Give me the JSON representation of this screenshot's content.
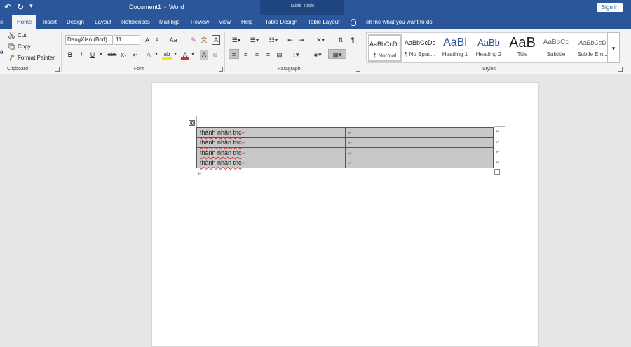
{
  "titlebar": {
    "document": "Document1",
    "separator": "-",
    "app": "Word",
    "table_tools": "Table Tools",
    "sign_in": "Sign in",
    "undo_icon": "↶",
    "redo_icon": "↻",
    "qat_more_icon": "▾"
  },
  "tabs": {
    "file": "e",
    "home": "Home",
    "insert": "Insert",
    "design": "Design",
    "layout": "Layout",
    "references": "References",
    "mailings": "Mailings",
    "review": "Review",
    "view": "View",
    "help": "Help",
    "table_design": "Table Design",
    "table_layout": "Table Layout",
    "tell_me": "Tell me what you want to do"
  },
  "clipboard": {
    "paste_fragment": "e",
    "cut": "Cut",
    "copy": "Copy",
    "format_painter": "Format Painter",
    "label": "Clipboard"
  },
  "font": {
    "family": "DengXian (Bod)",
    "size": "11",
    "grow": "A",
    "shrink": "A",
    "case": "Aa",
    "bold": "B",
    "italic": "I",
    "underline": "U",
    "strike": "abc",
    "subscript": "x₂",
    "superscript": "x²",
    "text_effects": "A",
    "highlight": "ab",
    "font_color": "A",
    "char_shading": "A",
    "label": "Font",
    "font_color_hex": "#d0312d",
    "highlight_hex": "#f5e31a"
  },
  "paragraph": {
    "label": "Paragraph",
    "show_marks": "¶"
  },
  "styles": {
    "label": "Styles",
    "items": [
      {
        "preview": "AaBbCcDc",
        "name": "¶ Normal"
      },
      {
        "preview": "AaBbCcDc",
        "name": "¶ No Spac..."
      },
      {
        "preview": "AaBl",
        "name": "Heading 1"
      },
      {
        "preview": "AaBb",
        "name": "Heading 2"
      },
      {
        "preview": "AaB",
        "name": "Title"
      },
      {
        "preview": "AaBbCc",
        "name": "Subtitle"
      },
      {
        "preview": "AaBbCcD",
        "name": "Subtle Em..."
      }
    ],
    "more_icon": "▾"
  },
  "document": {
    "table_move_icon": "⊕",
    "rows": [
      {
        "col1": "thành nhận tnc",
        "col2": ""
      },
      {
        "col1": "thành nhận tnc",
        "col2": ""
      },
      {
        "col1": "thành nhận tnc",
        "col2": ""
      },
      {
        "col1": "thành nhận tnc",
        "col2": ""
      }
    ],
    "end_of_cell_mark": "↵",
    "paragraph_mark": "↵"
  },
  "colors": {
    "title_bar": "#2b579a",
    "table_tools_band": "#1f4680",
    "ribbon": "#f3f3f3",
    "canvas": "#e6e6e6",
    "cell_shading": "#c8c8c8"
  }
}
